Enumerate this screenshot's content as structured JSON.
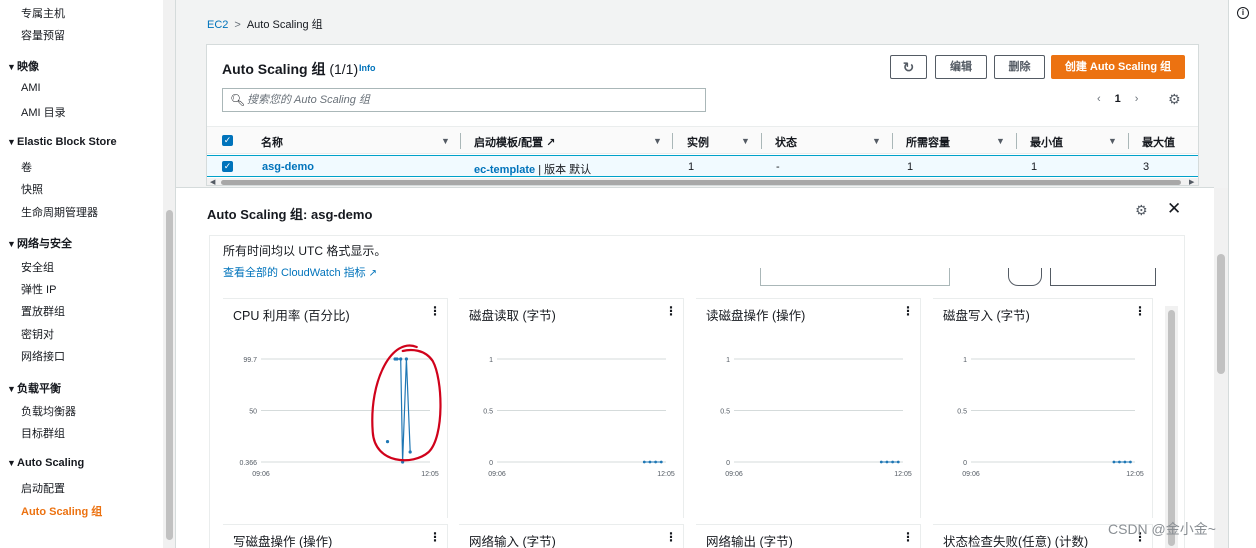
{
  "sidebar": {
    "items": [
      {
        "label": "专属主机",
        "type": "item"
      },
      {
        "label": "容量预留",
        "type": "item"
      },
      {
        "label": "映像",
        "type": "section"
      },
      {
        "label": "AMI",
        "type": "item"
      },
      {
        "label": "AMI 目录",
        "type": "item"
      },
      {
        "label": "Elastic Block Store",
        "type": "section"
      },
      {
        "label": "卷",
        "type": "item"
      },
      {
        "label": "快照",
        "type": "item"
      },
      {
        "label": "生命周期管理器",
        "type": "item"
      },
      {
        "label": "网络与安全",
        "type": "section"
      },
      {
        "label": "安全组",
        "type": "item"
      },
      {
        "label": "弹性 IP",
        "type": "item"
      },
      {
        "label": "置放群组",
        "type": "item"
      },
      {
        "label": "密钥对",
        "type": "item"
      },
      {
        "label": "网络接口",
        "type": "item"
      },
      {
        "label": "负载平衡",
        "type": "section"
      },
      {
        "label": "负载均衡器",
        "type": "item"
      },
      {
        "label": "目标群组",
        "type": "item"
      },
      {
        "label": "Auto Scaling",
        "type": "section"
      },
      {
        "label": "启动配置",
        "type": "item"
      },
      {
        "label": "Auto Scaling 组",
        "type": "item",
        "active": true
      }
    ]
  },
  "breadcrumb": {
    "root": "EC2",
    "sep": ">",
    "current": "Auto Scaling 组"
  },
  "asg_panel": {
    "title": "Auto Scaling 组",
    "count": "(1/1)",
    "info": "Info",
    "buttons": {
      "refresh": "↻",
      "edit": "编辑",
      "delete": "删除",
      "create": "创建 Auto Scaling 组"
    },
    "search_placeholder": "搜索您的 Auto Scaling 组",
    "pager": {
      "prev": "‹",
      "page": "1",
      "next": "›"
    },
    "columns": [
      "名称",
      "启动模板/配置",
      "实例",
      "状态",
      "所需容量",
      "最小值",
      "最大值"
    ],
    "row": {
      "name": "asg-demo",
      "template": "ec-template",
      "template_suffix": " | 版本 默认",
      "instances": "1",
      "status": "-",
      "desired": "1",
      "min": "1",
      "max": "3"
    }
  },
  "detail": {
    "title": "Auto Scaling 组: asg-demo",
    "tz_note": "所有时间均以 UTC 格式显示。",
    "cw_link": "查看全部的 CloudWatch 指标",
    "metrics": [
      {
        "title": "CPU 利用率 (百分比)",
        "menu": "⋮"
      },
      {
        "title": "磁盘读取 (字节)",
        "menu": "⋮"
      },
      {
        "title": "读磁盘操作 (操作)",
        "menu": "⋮"
      },
      {
        "title": "磁盘写入 (字节)",
        "menu": "⋮"
      }
    ],
    "metrics_row2": [
      {
        "title": "写磁盘操作 (操作)",
        "menu": "⋮"
      },
      {
        "title": "网络输入 (字节)",
        "menu": "⋮"
      },
      {
        "title": "网络输出 (字节)",
        "menu": "⋮"
      },
      {
        "title": "状态检查失败(任意) (计数)",
        "menu": "⋮"
      }
    ]
  },
  "chart_data": [
    {
      "type": "line",
      "title": "CPU 利用率 (百分比)",
      "yticks": [
        "99.7",
        "50",
        "0.366"
      ],
      "ylim": [
        0.366,
        99.7
      ],
      "xticks": [
        "09:06",
        "12:05"
      ],
      "series": [
        {
          "values": [
            {
              "x": "11:20",
              "y": 20
            },
            {
              "x": "11:28",
              "y": 99.7
            },
            {
              "x": "11:30",
              "y": 99.7
            },
            {
              "x": "11:34",
              "y": 99.7
            },
            {
              "x": "11:36",
              "y": 0.366
            },
            {
              "x": "11:40",
              "y": 99.7
            },
            {
              "x": "11:44",
              "y": 10
            }
          ]
        }
      ],
      "annotation_color": "#d0021b"
    },
    {
      "type": "line",
      "title": "磁盘读取 (字节)",
      "yticks": [
        "1",
        "0.5",
        "0"
      ],
      "ylim": [
        0,
        1
      ],
      "xticks": [
        "09:06",
        "12:05"
      ],
      "series": [
        {
          "values": [
            {
              "x": "11:42",
              "y": 0
            },
            {
              "x": "11:48",
              "y": 0
            },
            {
              "x": "11:54",
              "y": 0
            },
            {
              "x": "12:00",
              "y": 0
            }
          ]
        }
      ]
    },
    {
      "type": "line",
      "title": "读磁盘操作 (操作)",
      "yticks": [
        "1",
        "0.5",
        "0"
      ],
      "ylim": [
        0,
        1
      ],
      "xticks": [
        "09:06",
        "12:05"
      ],
      "series": [
        {
          "values": [
            {
              "x": "11:42",
              "y": 0
            },
            {
              "x": "11:48",
              "y": 0
            },
            {
              "x": "11:54",
              "y": 0
            },
            {
              "x": "12:00",
              "y": 0
            }
          ]
        }
      ]
    },
    {
      "type": "line",
      "title": "磁盘写入 (字节)",
      "yticks": [
        "1",
        "0.5",
        "0"
      ],
      "ylim": [
        0,
        1
      ],
      "xticks": [
        "09:06",
        "12:05"
      ],
      "series": [
        {
          "values": [
            {
              "x": "11:42",
              "y": 0
            },
            {
              "x": "11:48",
              "y": 0
            },
            {
              "x": "11:54",
              "y": 0
            },
            {
              "x": "12:00",
              "y": 0
            }
          ]
        }
      ]
    }
  ],
  "watermark": "CSDN @金小金~",
  "colors": {
    "accent": "#ec7211",
    "link": "#0073bb",
    "series": "#1f77b4",
    "annotation": "#d0021b"
  }
}
